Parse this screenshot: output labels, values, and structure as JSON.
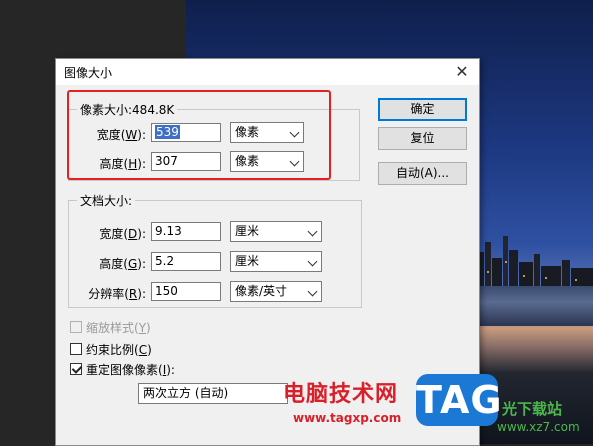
{
  "dialog": {
    "title": "图像大小",
    "close_glyph": "✕",
    "pixel_dimensions": {
      "legend": "像素大小:484.8K",
      "width_label_pre": "宽度(",
      "width_label_key": "W",
      "width_label_post": "):",
      "width_value": "539",
      "width_unit": "像素",
      "height_label_pre": "高度(",
      "height_label_key": "H",
      "height_label_post": "):",
      "height_value": "307",
      "height_unit": "像素"
    },
    "document_size": {
      "legend": "文档大小:",
      "width_label_pre": "宽度(",
      "width_label_key": "D",
      "width_label_post": "):",
      "width_value": "9.13",
      "width_unit": "厘米",
      "height_label_pre": "高度(",
      "height_label_key": "G",
      "height_label_post": "):",
      "height_value": "5.2",
      "height_unit": "厘米",
      "resolution_label_pre": "分辨率(",
      "resolution_label_key": "R",
      "resolution_label_post": "):",
      "resolution_value": "150",
      "resolution_unit": "像素/英寸"
    },
    "buttons": {
      "ok": "确定",
      "reset": "复位",
      "auto": "自动(A)..."
    },
    "options": {
      "scale_styles": {
        "label_pre": "缩放样式(",
        "label_key": "Y",
        "label_post": ")",
        "checked": false,
        "enabled": false
      },
      "constrain": {
        "label_pre": "约束比例(",
        "label_key": "C",
        "label_post": ")",
        "checked": false,
        "enabled": true
      },
      "resample": {
        "label_pre": "重定图像像素(",
        "label_key": "I",
        "label_post": "):",
        "checked": true,
        "enabled": true
      },
      "resample_method": "两次立方 (自动)"
    }
  },
  "watermark": {
    "title": "电脑技术网",
    "url": "www.tagxp.com",
    "logo": "TAG",
    "right_text": "光下载站",
    "right_url": "www.xz7.com"
  },
  "colors": {
    "highlight_box": "#e52020",
    "selection": "#3d6fc7",
    "primary_border": "#0078d7"
  }
}
